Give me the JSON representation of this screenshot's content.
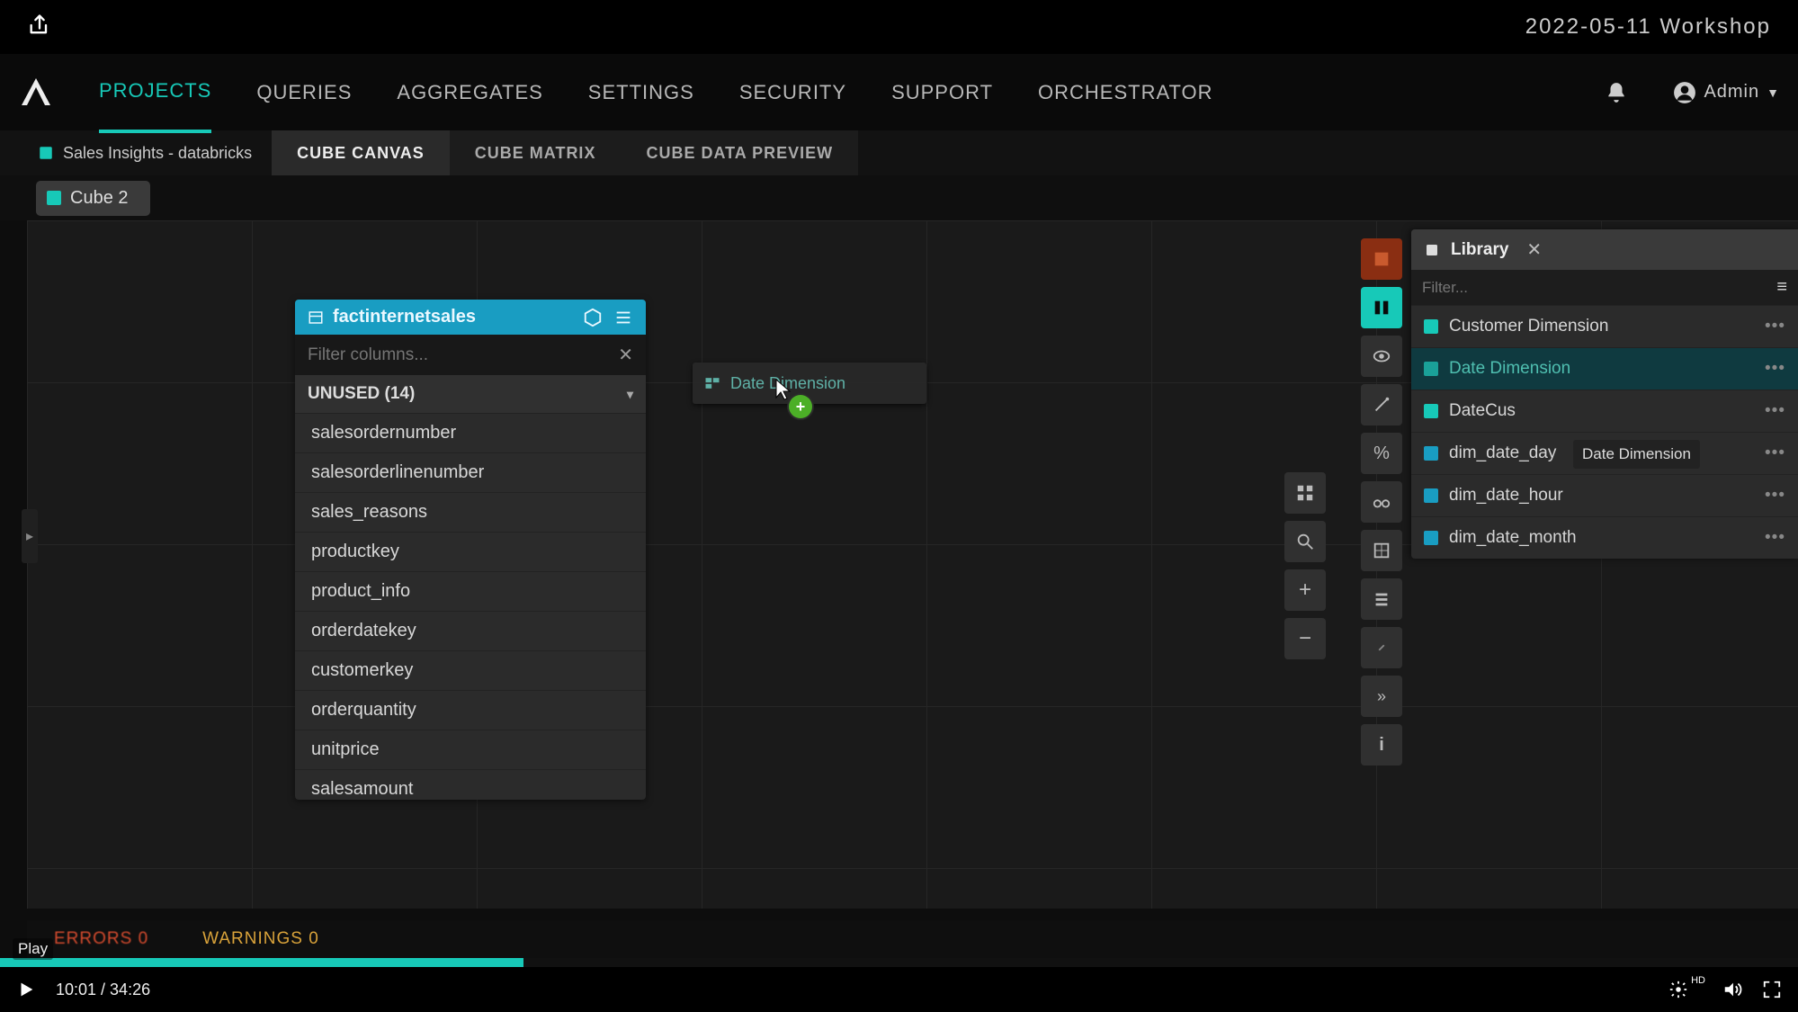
{
  "top": {
    "workshop": "2022-05-11 Workshop"
  },
  "nav": {
    "items": [
      "PROJECTS",
      "QUERIES",
      "AGGREGATES",
      "SETTINGS",
      "SECURITY",
      "SUPPORT",
      "ORCHESTRATOR"
    ],
    "active": 0,
    "user": "Admin"
  },
  "sub": {
    "crumb": "Sales Insights - databricks",
    "tabs": [
      "CUBE CANVAS",
      "CUBE MATRIX",
      "CUBE DATA PREVIEW"
    ],
    "active": 0
  },
  "chip": {
    "label": "Cube 2"
  },
  "panel": {
    "title": "factinternetsales",
    "filter_placeholder": "Filter columns...",
    "section": "UNUSED (14)",
    "columns": [
      "salesordernumber",
      "salesorderlinenumber",
      "sales_reasons",
      "productkey",
      "product_info",
      "orderdatekey",
      "customerkey",
      "orderquantity",
      "unitprice",
      "salesamount"
    ]
  },
  "drag": {
    "label": "Date Dimension",
    "badge": "+"
  },
  "library": {
    "title": "Library",
    "filter_placeholder": "Filter...",
    "tooltip": "Date Dimension",
    "items": [
      {
        "label": "Customer Dimension",
        "swatch": "t1",
        "sel": false
      },
      {
        "label": "Date Dimension",
        "swatch": "t3",
        "sel": true
      },
      {
        "label": "DateCus",
        "swatch": "t1",
        "sel": false
      },
      {
        "label": "dim_date_day",
        "swatch": "t2",
        "sel": false
      },
      {
        "label": "dim_date_hour",
        "swatch": "t2",
        "sel": false
      },
      {
        "label": "dim_date_month",
        "swatch": "t2",
        "sel": false
      }
    ]
  },
  "status": {
    "errors": "ERRORS 0",
    "warnings": "WARNINGS 0"
  },
  "video": {
    "play_tooltip": "Play",
    "time": "10:01 / 34:26",
    "hd": "HD"
  }
}
